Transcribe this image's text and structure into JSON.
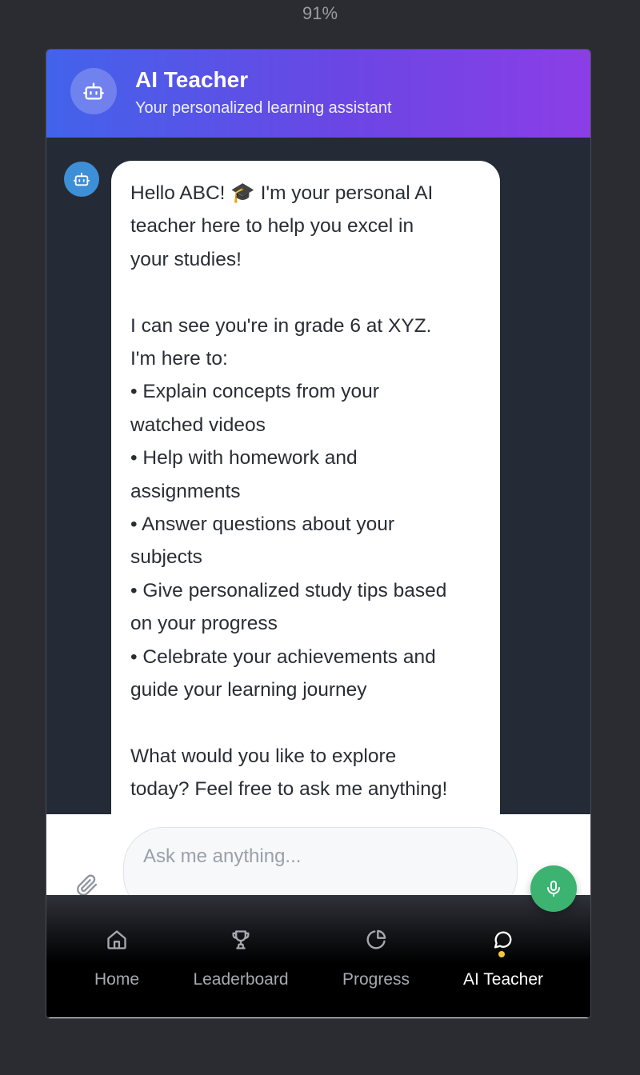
{
  "zoom": "91%",
  "header": {
    "title": "AI Teacher",
    "subtitle": "Your personalized learning assistant",
    "avatar_icon": "robot-icon"
  },
  "chat": {
    "bot_icon": "robot-icon",
    "message_lines": [
      "Hello ABC! 🎓 I'm your personal AI",
      "teacher here to help you excel in",
      "your studies!",
      "",
      "I can see you're in grade 6 at XYZ.",
      "I'm here to:",
      "• Explain concepts from your",
      "watched videos",
      "• Help with homework and",
      "assignments",
      "• Answer questions about your",
      "subjects",
      "• Give personalized study tips based",
      "on your progress",
      "• Celebrate your achievements and",
      "guide your learning journey",
      "",
      "What would you like to explore",
      "today? Feel free to ask me anything!"
    ]
  },
  "input": {
    "placeholder": "Ask me anything...",
    "value": "",
    "attach_icon": "paperclip-icon",
    "mic_icon": "microphone-icon"
  },
  "nav": {
    "items": [
      {
        "label": "Home",
        "icon": "home-icon",
        "active": false
      },
      {
        "label": "Leaderboard",
        "icon": "trophy-icon",
        "active": false
      },
      {
        "label": "Progress",
        "icon": "pie-chart-icon",
        "active": false
      },
      {
        "label": "AI Teacher",
        "icon": "chat-bubble-icon",
        "active": true
      }
    ]
  },
  "colors": {
    "header_gradient_start": "#4263eb",
    "header_gradient_end": "#8b3ee6",
    "mic_button": "#3cb371",
    "active_dot": "#f5c542",
    "bot_avatar": "#3d8fd8"
  }
}
